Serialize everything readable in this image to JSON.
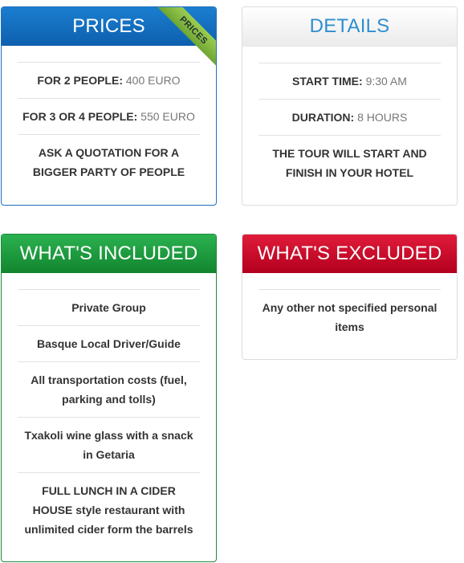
{
  "prices": {
    "title": "PRICES",
    "ribbon": "PRICES",
    "rows": [
      {
        "label": "FOR 2 PEOPLE:",
        "value": "400 EURO"
      },
      {
        "label": "FOR 3 OR 4 PEOPLE:",
        "value": "550 EURO"
      },
      {
        "label": "ASK A QUOTATION FOR A BIGGER PARTY OF PEOPLE",
        "value": ""
      }
    ]
  },
  "details": {
    "title": "DETAILS",
    "rows": [
      {
        "label": "START TIME:",
        "value": "9:30 AM"
      },
      {
        "label": "DURATION:",
        "value": "8 HOURS"
      },
      {
        "label": "THE TOUR WILL START AND FINISH IN YOUR HOTEL",
        "value": ""
      }
    ]
  },
  "included": {
    "title": "WHAT'S INCLUDED",
    "items": [
      "Private Group",
      "Basque Local Driver/Guide",
      "All transportation costs (fuel, parking and tolls)",
      "Txakoli wine glass with a snack in Getaria",
      "FULL LUNCH IN A CIDER HOUSE style restaurant with unlimited cider form the barrels"
    ]
  },
  "excluded": {
    "title": "WHAT'S EXCLUDED",
    "items": [
      "Any other not specified personal items"
    ]
  },
  "colors": {
    "prices_header": "#0d5fae",
    "details_header_text": "#2e8fcf",
    "included_header": "#12852e",
    "excluded_header": "#b3001e",
    "ribbon": "#8cc63f"
  }
}
